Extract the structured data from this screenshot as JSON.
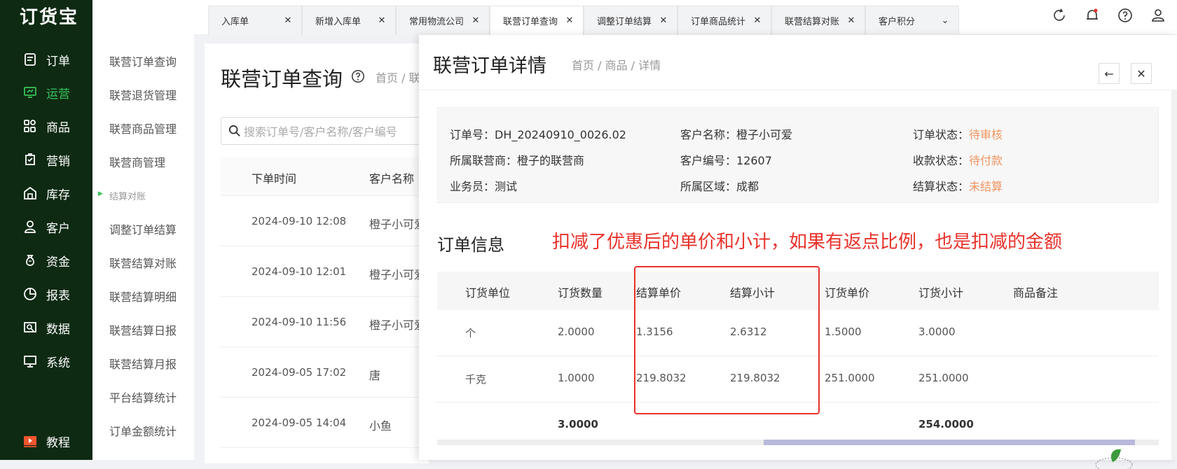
{
  "app": {
    "logo": "订货宝"
  },
  "nav": [
    {
      "label": "订单",
      "icon": "order-icon"
    },
    {
      "label": "运营",
      "icon": "monitor-chat-icon",
      "active": true
    },
    {
      "label": "商品",
      "icon": "grid-icon"
    },
    {
      "label": "营销",
      "icon": "marketing-icon"
    },
    {
      "label": "库存",
      "icon": "warehouse-icon"
    },
    {
      "label": "客户",
      "icon": "user-icon"
    },
    {
      "label": "资金",
      "icon": "money-bag-icon"
    },
    {
      "label": "报表",
      "icon": "pie-chart-icon"
    },
    {
      "label": "数据",
      "icon": "data-icon"
    },
    {
      "label": "系统",
      "icon": "monitor-icon"
    },
    {
      "label": "教程",
      "icon": "video-icon"
    }
  ],
  "submenu": [
    "联营订单查询",
    "联营退货管理",
    "联营商品管理",
    "联营商管理",
    "结算对账",
    "调整订单结算",
    "联营结算对账",
    "联营结算明细",
    "联营结算日报",
    "联营结算月报",
    "平台结算统计",
    "订单金额统计"
  ],
  "tabs": [
    "入库单",
    "新增入库单",
    "常用物流公司",
    "联营订单查询",
    "调整订单结算",
    "订单商品统计",
    "联营结算对账",
    "客户积分"
  ],
  "page": {
    "title": "联营订单查询",
    "breadcrumb": "首页 / 联",
    "search_placeholder": "搜索订单号/客户名称/客户编号",
    "col_time": "下单时间",
    "col_customer": "客户名称",
    "rows": [
      {
        "time": "2024-09-10 12:08",
        "name": "橙子小可爱"
      },
      {
        "time": "2024-09-10 12:01",
        "name": "橙子小可爱"
      },
      {
        "time": "2024-09-10 11:56",
        "name": "橙子小可爱"
      },
      {
        "time": "2024-09-05 17:02",
        "name": "唐"
      },
      {
        "time": "2024-09-05 14:04",
        "name": "小鱼"
      }
    ]
  },
  "drawer": {
    "title": "联营订单详情",
    "breadcrumb": "首页 / 商品 / 详情",
    "info": {
      "order_no_label": "订单号：",
      "order_no": "DH_20240910_0026.02",
      "agent_label": "所属联营商：",
      "agent": "橙子的联营商",
      "sales_label": "业务员：",
      "sales": "测试",
      "customer_label": "客户名称：",
      "customer": "橙子小可爱",
      "cust_no_label": "客户编号：",
      "cust_no": "12607",
      "region_label": "所属区域：",
      "region": "成都",
      "status_label": "订单状态：",
      "status": "待审核",
      "pay_label": "收款状态：",
      "pay": "待付款",
      "settle_label": "结算状态：",
      "settle": "未结算"
    },
    "section_title": "订单信息",
    "note": "扣减了优惠后的单价和小计，如果有返点比例，也是扣减的金额",
    "table": {
      "headers": [
        "订货单位",
        "订货数量",
        "结算单价",
        "结算小计",
        "订货单价",
        "订货小计",
        "商品备注"
      ],
      "rows": [
        {
          "unit": "个",
          "qty": "2.0000",
          "s_price": "1.3156",
          "s_sub": "2.6312",
          "price": "1.5000",
          "sub": "3.0000",
          "remark": ""
        },
        {
          "unit": "千克",
          "qty": "1.0000",
          "s_price": "219.8032",
          "s_sub": "219.8032",
          "price": "251.0000",
          "sub": "251.0000",
          "remark": ""
        }
      ],
      "total_qty": "3.0000",
      "total_sub": "254.0000"
    }
  }
}
